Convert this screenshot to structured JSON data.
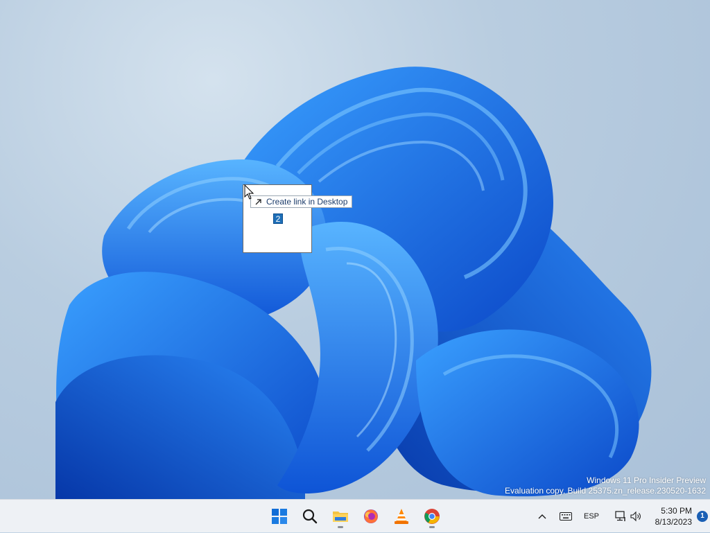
{
  "drag": {
    "tooltip_label": "Create link in Desktop",
    "item_count": "2",
    "tooltip_icon": "link-arrow-icon"
  },
  "watermark": {
    "line1": "Windows 11 Pro Insider Preview",
    "line2": "Evaluation copy. Build 25375.zn_release.230520-1632"
  },
  "taskbar": {
    "apps": [
      {
        "name": "Start",
        "icon": "windows-logo-icon"
      },
      {
        "name": "Search",
        "icon": "search-icon"
      },
      {
        "name": "File Explorer",
        "icon": "folder-icon",
        "running": true
      },
      {
        "name": "Firefox",
        "icon": "firefox-icon"
      },
      {
        "name": "VLC media player",
        "icon": "vlc-icon"
      },
      {
        "name": "Google Chrome",
        "icon": "chrome-icon",
        "running": true
      }
    ],
    "tray": {
      "language": "ESP",
      "time": "5:30 PM",
      "date": "8/13/2023",
      "notification_count": "1"
    }
  },
  "colors": {
    "accent": "#1e6fb8",
    "taskbar_bg": "#eef1f5",
    "wallpaper_bloom": "#1a6cf0"
  }
}
